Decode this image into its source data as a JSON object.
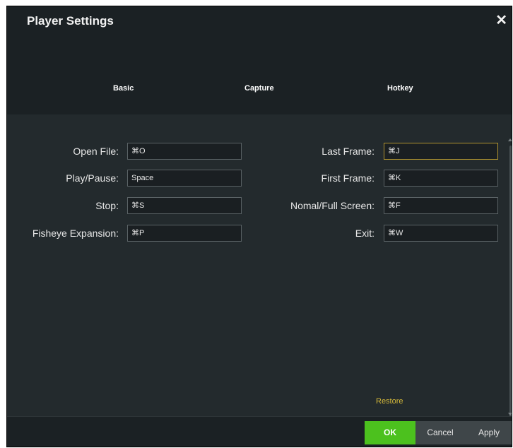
{
  "dialog": {
    "title": "Player Settings",
    "close_icon": "close-icon"
  },
  "tabs": [
    {
      "label": "Basic"
    },
    {
      "label": "Capture"
    },
    {
      "label": "Hotkey"
    }
  ],
  "hotkeys": {
    "left": [
      {
        "label": "Open File:",
        "value": "⌘O"
      },
      {
        "label": "Play/Pause:",
        "value": "Space"
      },
      {
        "label": "Stop:",
        "value": "⌘S"
      },
      {
        "label": "Fisheye Expansion:",
        "value": "⌘P"
      }
    ],
    "right": [
      {
        "label": "Last Frame:",
        "value": "⌘J"
      },
      {
        "label": "First Frame:",
        "value": "⌘K"
      },
      {
        "label": "Nomal/Full Screen:",
        "value": "⌘F"
      },
      {
        "label": "Exit:",
        "value": "⌘W"
      }
    ]
  },
  "restore_label": "Restore",
  "footer": {
    "ok_label": "OK",
    "cancel_label": "Cancel",
    "apply_label": "Apply"
  },
  "colors": {
    "background": "#1b2124",
    "panel": "#232a2d",
    "accent_green": "#4cc11e",
    "restore_yellow": "#d4b83a",
    "focus_border": "#b09430"
  }
}
